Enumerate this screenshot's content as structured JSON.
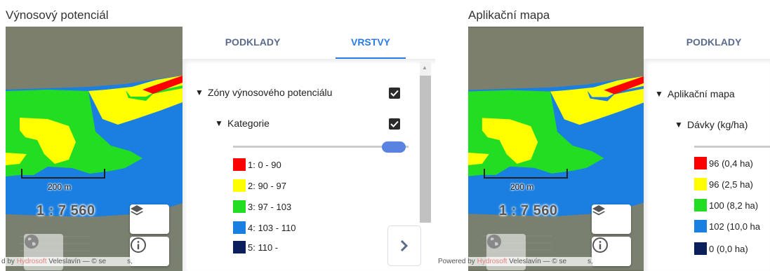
{
  "left_panel": {
    "title": "Výnosový potenciál",
    "tabs": [
      {
        "label": "PODKLADY",
        "active": false
      },
      {
        "label": "VRSTVY",
        "active": true
      }
    ],
    "layer_group": "Zóny výnosového potenciálu",
    "sublayer": "Kategorie",
    "legend": [
      {
        "label": "1: 0 - 90",
        "color": "#ff0000"
      },
      {
        "label": "2: 90 - 97",
        "color": "#ffff00"
      },
      {
        "label": "3: 97 - 103",
        "color": "#22dd22"
      },
      {
        "label": "4: 103 - 110",
        "color": "#1a7fe0"
      },
      {
        "label": "5: 110 -",
        "color": "#0a1f5c"
      }
    ],
    "scale_label": "200 m",
    "scale_ratio": "1 : 7 560",
    "attribution": {
      "pre": "d by ",
      "brand": "Hydrosoft",
      "post": " Veleslavín — © se",
      "tail": "s,"
    }
  },
  "right_panel": {
    "title": "Aplikační mapa",
    "tabs": [
      {
        "label": "PODKLADY",
        "active": false
      }
    ],
    "layer_group": "Aplikační mapa",
    "sublayer": "Dávky (kg/ha)",
    "legend": [
      {
        "label": "96 (0,4 ha)",
        "color": "#ff0000"
      },
      {
        "label": "96 (2,5 ha)",
        "color": "#ffff00"
      },
      {
        "label": "100 (8,2 ha)",
        "color": "#22dd22"
      },
      {
        "label": "102 (10,0 ha",
        "color": "#1a7fe0"
      },
      {
        "label": "0 (0,0 ha)",
        "color": "#0a1f5c"
      }
    ],
    "scale_label": "200 m",
    "scale_ratio": "1 : 7 560",
    "attribution": {
      "pre": "Powered by ",
      "brand": "Hydrosoft",
      "post": " Veleslavín — © se",
      "tail": "s,"
    }
  },
  "icons": {
    "layers": "layers-stack-icon",
    "info": "info-circle-icon",
    "globe": "globe-icon",
    "chevron_down": "chevron-down-icon",
    "chevron_right": "chevron-right-icon",
    "checkbox": "checkbox-checked-icon"
  }
}
